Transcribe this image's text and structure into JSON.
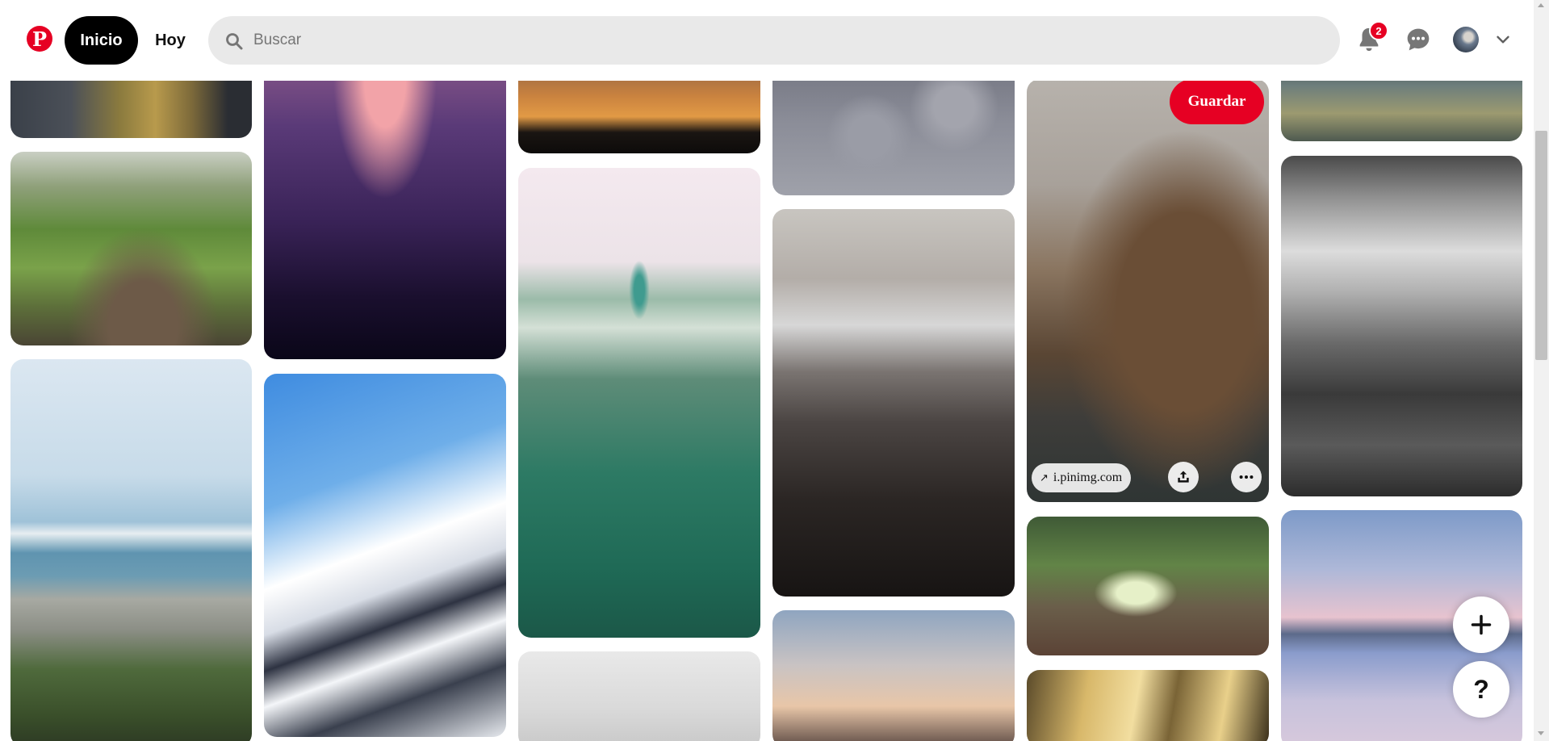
{
  "header": {
    "logo_icon": "pinterest-logo",
    "logo_glyph": "P",
    "nav": {
      "home_label": "Inicio",
      "today_label": "Hoy"
    },
    "search": {
      "placeholder": "Buscar",
      "value": "",
      "icon": "search-icon"
    },
    "notifications": {
      "icon": "bell-icon",
      "badge_count": "2"
    },
    "messages": {
      "icon": "chat-bubble-icon"
    },
    "account": {
      "avatar_icon": "avatar",
      "menu_icon": "chevron-down-icon"
    }
  },
  "hovered_pin": {
    "save_label": "Guardar",
    "link_text": "i.pinimg.com",
    "share_icon": "share-icon",
    "more_icon": "more-icon"
  },
  "fabs": {
    "create_icon": "plus-icon",
    "help_label": "?"
  },
  "colors": {
    "brand": "#e60023",
    "search_bg": "#e9e9e9",
    "active_nav_bg": "#000000"
  }
}
